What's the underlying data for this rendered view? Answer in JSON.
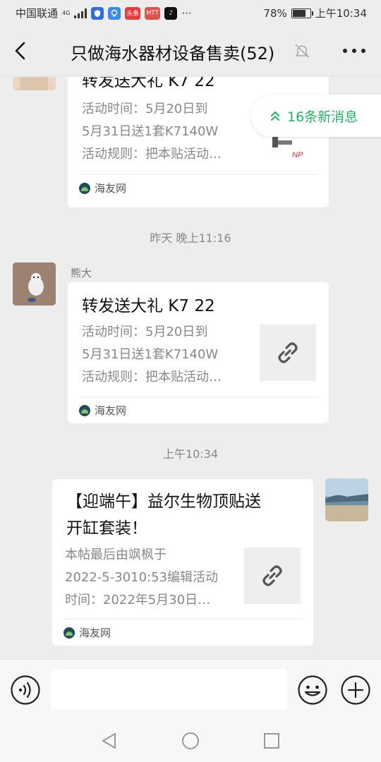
{
  "status_bar": {
    "carrier": "中国联通",
    "network": "4G",
    "battery": "78%",
    "battery_level": 0.78,
    "time": "上午10:34",
    "app_icons": [
      "shield-app-icon",
      "bulb-app-icon",
      "toutiao-app-icon",
      "news-app-icon",
      "tiktok-app-icon"
    ],
    "app_labels": [
      "",
      "",
      "头条",
      "HTT",
      "♪"
    ],
    "more": "···"
  },
  "header": {
    "title": "只做海水器材设备售卖(52)",
    "muted": true
  },
  "new_messages": {
    "label": "16条新消息",
    "icon": "double-chevron-up-icon"
  },
  "messages": [
    {
      "sender": "",
      "title": "转发送大礼 K7 22",
      "desc": [
        "活动时间：5月20日到",
        "5月31日送1套K7140W",
        "活动规则：把本贴活动…"
      ],
      "source": "海友网",
      "thumb_icon": "product-image"
    },
    {
      "time": "昨天 晚上11:16"
    },
    {
      "sender": "熊大",
      "title": "转发送大礼 K7 22",
      "desc": [
        "活动时间：5月20日到",
        "5月31日送1套K7140W",
        "活动规则：把本贴活动…"
      ],
      "source": "海友网",
      "thumb_icon": "link-icon"
    },
    {
      "time": "上午10:34"
    },
    {
      "sender": "",
      "title": [
        "【迎端午】益尔生物顶贴送",
        "开缸套装！"
      ],
      "desc": [
        "本帖最后由飒枫于",
        "2022-5-3010:53编辑活动",
        "时间：2022年5月30日…"
      ],
      "source": "海友网",
      "thumb_icon": "link-icon"
    }
  ],
  "input_bar": {
    "placeholder": "",
    "voice_icon": "voice-icon",
    "emoji_icon": "emoji-icon",
    "plus_icon": "plus-icon"
  },
  "colors": {
    "background": "#ededed",
    "accent_green": "#2aae67",
    "card": "#ffffff"
  }
}
